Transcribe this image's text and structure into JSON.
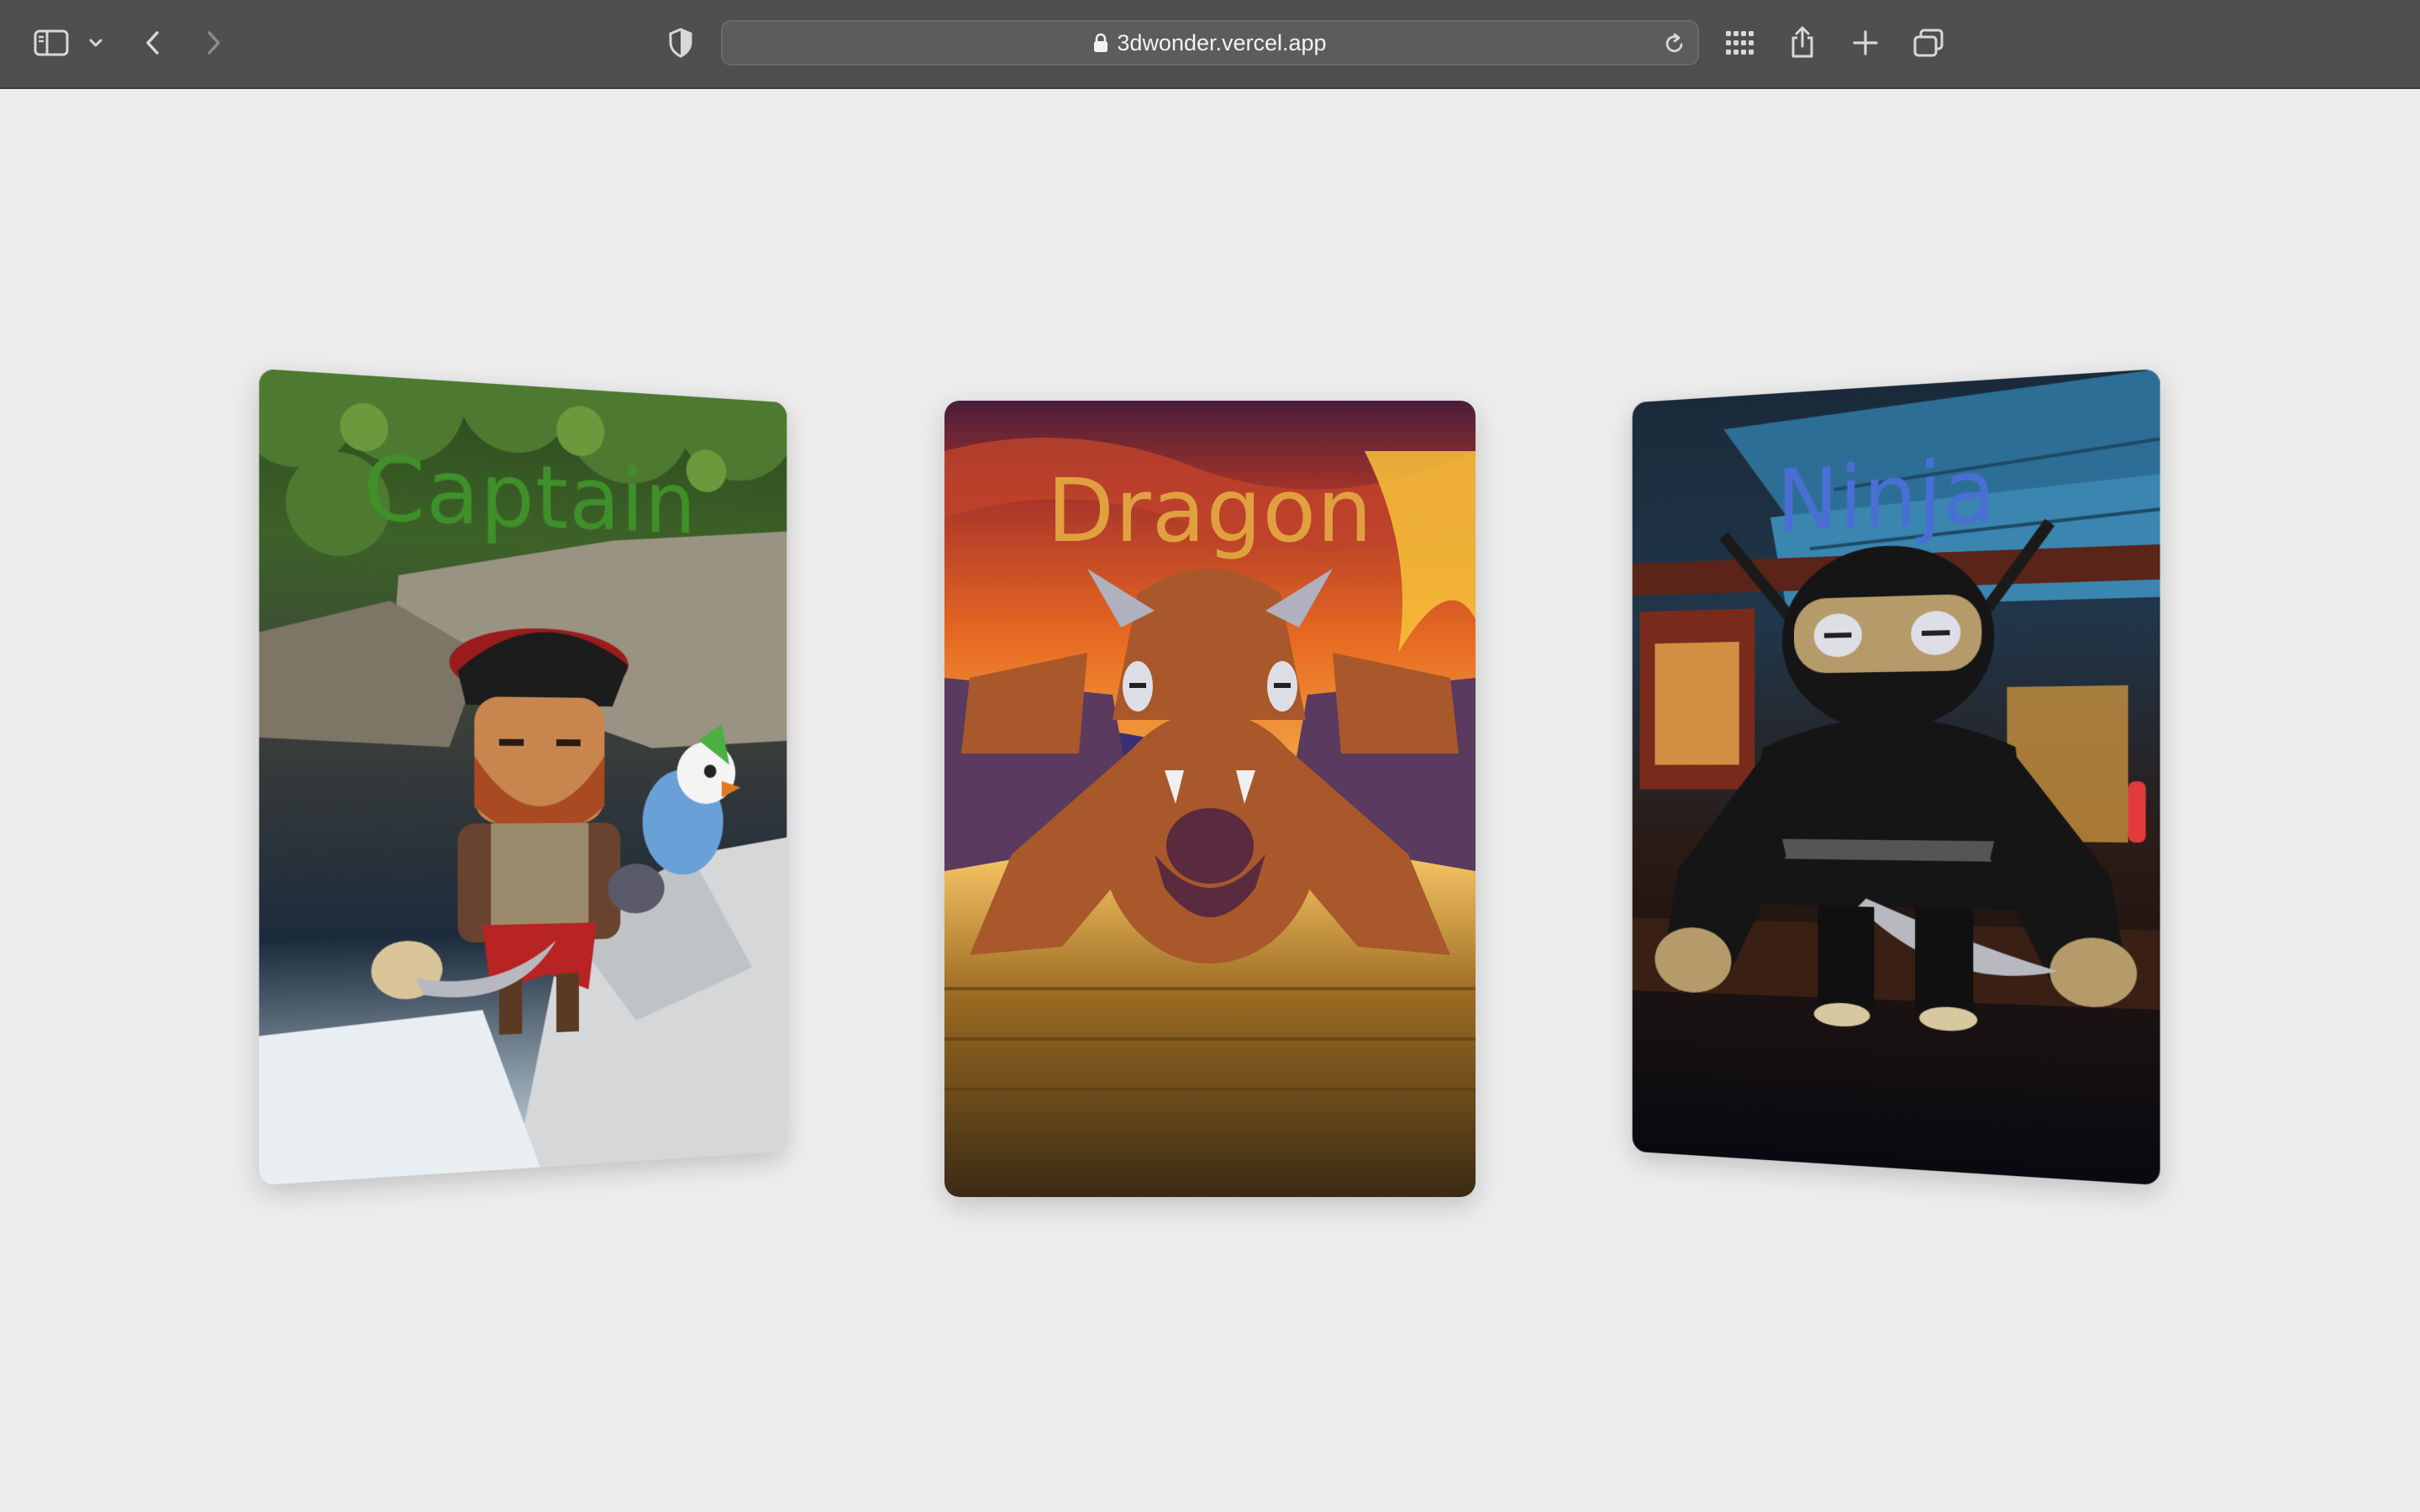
{
  "browser": {
    "url": "3dwonder.vercel.app",
    "icons": [
      "sidebar-icon",
      "chevron-down-icon",
      "back-icon",
      "forward-icon",
      "shield-icon",
      "lock-icon",
      "reload-icon",
      "grid-icon",
      "share-icon",
      "plus-icon",
      "tabs-icon"
    ]
  },
  "cards": [
    {
      "title": "Captain",
      "color": "#3f8f2a"
    },
    {
      "title": "Dragon",
      "color": "#e0a040"
    },
    {
      "title": "Ninja",
      "color": "#4a6fd4"
    }
  ]
}
